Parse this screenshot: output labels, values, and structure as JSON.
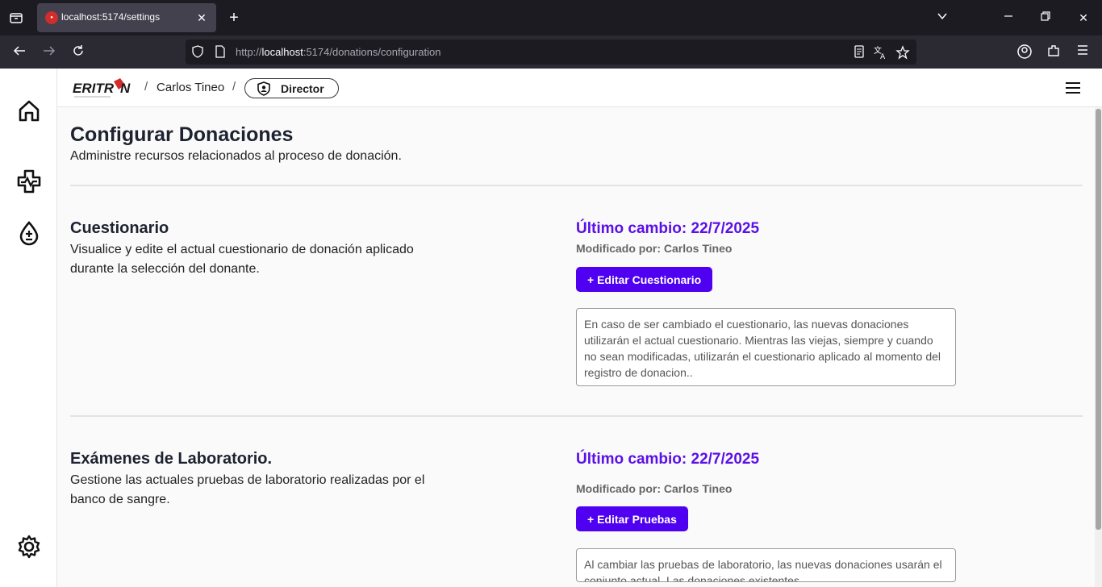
{
  "browser": {
    "tab_title": "localhost:5174/settings",
    "url_prefix": "http://",
    "url_host": "localhost",
    "url_rest": ":5174/donations/configuration"
  },
  "header": {
    "logo_text": "ERITRON",
    "user_name": "Carlos Tineo",
    "role": "Director"
  },
  "page": {
    "title": "Configurar Donaciones",
    "subtitle": "Administre recursos relacionados al proceso de donación."
  },
  "sections": [
    {
      "title": "Cuestionario",
      "description": "Visualice y edite el actual cuestionario de donación aplicado durante la selección del donante.",
      "last_change": "Último cambio: 22/7/2025",
      "modified_by": "Modificado por: Carlos Tineo",
      "button_label": "+ Editar Cuestionario",
      "note": "En caso de ser cambiado el cuestionario, las nuevas donaciones utilizarán el actual cuestionario. Mientras las viejas, siempre y cuando no sean modificadas, utilizarán el cuestionario aplicado al momento del registro de donacion.."
    },
    {
      "title": "Exámenes de Laboratorio.",
      "description": "Gestione las actuales pruebas de laboratorio realizadas por el banco de sangre.",
      "last_change": "Último cambio: 22/7/2025",
      "modified_by": "Modificado por: Carlos Tineo",
      "button_label": "+ Editar Pruebas",
      "note": "Al cambiar las pruebas de laboratorio, las nuevas donaciones usarán el conjunto actual. Las donaciones existentes"
    }
  ],
  "colors": {
    "accent": "#5000f0",
    "accent_text": "#5a10e6"
  }
}
